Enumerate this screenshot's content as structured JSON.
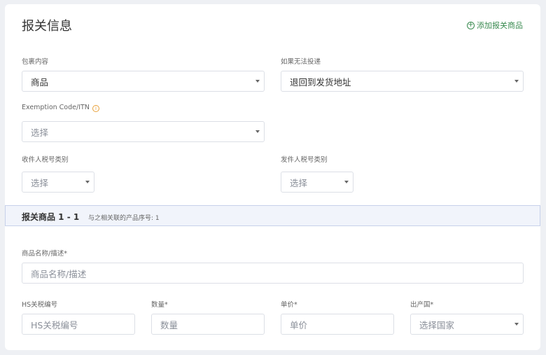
{
  "title": "报关信息",
  "add_link": "添加报关商品",
  "package_contents": {
    "label": "包裹内容",
    "value": "商品"
  },
  "undeliverable": {
    "label": "如果无法投递",
    "value": "退回到发货地址"
  },
  "exemption": {
    "label": "Exemption Code/ITN",
    "placeholder": "选择"
  },
  "receiver_tax": {
    "label": "收件人税号类别",
    "placeholder": "选择"
  },
  "sender_tax": {
    "label": "发件人税号类别",
    "placeholder": "选择"
  },
  "item_section": {
    "title": "报关商品 1 - 1",
    "subtitle": "与之相关联的产品序号: 1"
  },
  "item_name": {
    "label": "商品名称/描述*",
    "placeholder": "商品名称/描述"
  },
  "hs_code": {
    "label": "HS关税编号",
    "placeholder": "HS关税编号"
  },
  "quantity": {
    "label": "数量*",
    "placeholder": "数量"
  },
  "unit_price": {
    "label": "单价*",
    "placeholder": "单价"
  },
  "origin_country": {
    "label": "出产国*",
    "placeholder": "选择国家"
  },
  "colors": {
    "accent": "#3a8b50",
    "band_bg": "#f1f4fb",
    "band_border": "#c7d1ea",
    "info": "#e8a13a"
  }
}
